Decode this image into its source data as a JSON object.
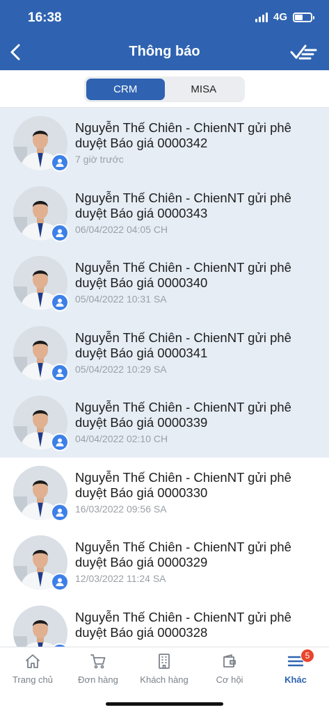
{
  "status_bar": {
    "time": "16:38",
    "network": "4G",
    "battery_level": 0.5
  },
  "nav": {
    "title": "Thông báo",
    "back_icon": "chevron-left-icon",
    "action_icon": "mark-all-read-icon"
  },
  "segments": [
    {
      "label": "CRM",
      "active": true
    },
    {
      "label": "MISA",
      "active": false
    }
  ],
  "notifications": [
    {
      "title": "Nguyễn Thế Chiên - ChienNT gửi phê duyệt Báo giá 0000342",
      "time": "7 giờ trước",
      "unread": true
    },
    {
      "title": "Nguyễn Thế Chiên - ChienNT gửi phê duyệt Báo giá 0000343",
      "time": "06/04/2022 04:05 CH",
      "unread": true
    },
    {
      "title": "Nguyễn Thế Chiên - ChienNT gửi phê duyệt Báo giá 0000340",
      "time": "05/04/2022 10:31 SA",
      "unread": true
    },
    {
      "title": "Nguyễn Thế Chiên - ChienNT gửi phê duyệt Báo giá 0000341",
      "time": "05/04/2022 10:29 SA",
      "unread": true
    },
    {
      "title": "Nguyễn Thế Chiên - ChienNT gửi phê duyệt Báo giá 0000339",
      "time": "04/04/2022 02:10 CH",
      "unread": true
    },
    {
      "title": "Nguyễn Thế Chiên - ChienNT gửi phê duyệt Báo giá 0000330",
      "time": "16/03/2022 09:56 SA",
      "unread": false
    },
    {
      "title": "Nguyễn Thế Chiên - ChienNT gửi phê duyệt Báo giá 0000329",
      "time": "12/03/2022 11:24 SA",
      "unread": false
    },
    {
      "title": "Nguyễn Thế Chiên - ChienNT gửi phê duyệt Báo giá 0000328",
      "time": "",
      "unread": false
    }
  ],
  "tabbar": {
    "items": [
      {
        "label": "Trang chủ",
        "icon": "home-icon",
        "active": false
      },
      {
        "label": "Đơn hàng",
        "icon": "cart-icon",
        "active": false
      },
      {
        "label": "Khách hàng",
        "icon": "building-icon",
        "active": false
      },
      {
        "label": "Cơ hội",
        "icon": "wallet-icon",
        "active": false
      },
      {
        "label": "Khác",
        "icon": "menu-icon",
        "active": true,
        "badge": "5"
      }
    ]
  },
  "colors": {
    "primary": "#2f63b1",
    "unread_bg": "#e6edf5",
    "badge": "#e8452c",
    "avatar_badge": "#3d80e8"
  }
}
